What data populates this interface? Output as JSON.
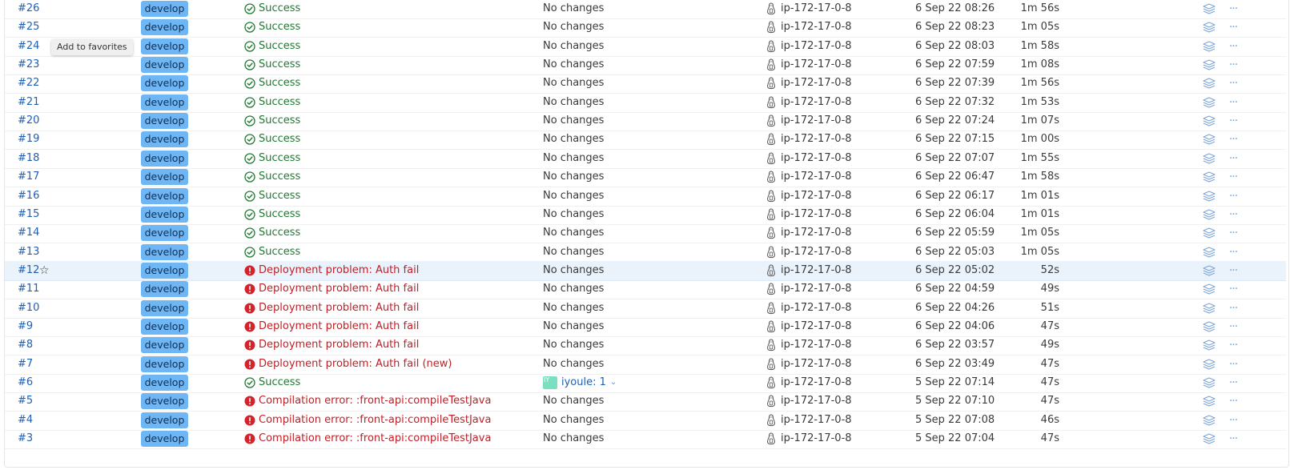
{
  "tooltip": "Add to favorites",
  "colors": {
    "success": "#1f7a32",
    "error": "#c01f27",
    "branch_badge": "#6fb7f4",
    "link": "#1f5fb4",
    "highlight_row": "#eaf3fc"
  },
  "icons": {
    "success": "check-circle-icon",
    "error": "exclamation-circle-icon",
    "agent": "linux-tux-icon",
    "artifacts": "layers-icon",
    "actions": "more-horizontal-icon",
    "favorite": "star-outline-icon"
  },
  "builds": [
    {
      "number": "#26",
      "branch": "develop",
      "status": "success",
      "status_text": "Success",
      "changes": "No changes",
      "agent": "ip-172-17-0-8",
      "started": "6 Sep 22 08:26",
      "duration": "1m 56s"
    },
    {
      "number": "#25",
      "branch": "develop",
      "status": "success",
      "status_text": "Success",
      "changes": "No changes",
      "agent": "ip-172-17-0-8",
      "started": "6 Sep 22 08:23",
      "duration": "1m 05s"
    },
    {
      "number": "#24",
      "branch": "develop",
      "status": "success",
      "status_text": "Success",
      "changes": "No changes",
      "agent": "ip-172-17-0-8",
      "started": "6 Sep 22 08:03",
      "duration": "1m 58s"
    },
    {
      "number": "#23",
      "branch": "develop",
      "status": "success",
      "status_text": "Success",
      "changes": "No changes",
      "agent": "ip-172-17-0-8",
      "started": "6 Sep 22 07:59",
      "duration": "1m 08s"
    },
    {
      "number": "#22",
      "branch": "develop",
      "status": "success",
      "status_text": "Success",
      "changes": "No changes",
      "agent": "ip-172-17-0-8",
      "started": "6 Sep 22 07:39",
      "duration": "1m 56s"
    },
    {
      "number": "#21",
      "branch": "develop",
      "status": "success",
      "status_text": "Success",
      "changes": "No changes",
      "agent": "ip-172-17-0-8",
      "started": "6 Sep 22 07:32",
      "duration": "1m 53s"
    },
    {
      "number": "#20",
      "branch": "develop",
      "status": "success",
      "status_text": "Success",
      "changes": "No changes",
      "agent": "ip-172-17-0-8",
      "started": "6 Sep 22 07:24",
      "duration": "1m 07s"
    },
    {
      "number": "#19",
      "branch": "develop",
      "status": "success",
      "status_text": "Success",
      "changes": "No changes",
      "agent": "ip-172-17-0-8",
      "started": "6 Sep 22 07:15",
      "duration": "1m 00s"
    },
    {
      "number": "#18",
      "branch": "develop",
      "status": "success",
      "status_text": "Success",
      "changes": "No changes",
      "agent": "ip-172-17-0-8",
      "started": "6 Sep 22 07:07",
      "duration": "1m 55s"
    },
    {
      "number": "#17",
      "branch": "develop",
      "status": "success",
      "status_text": "Success",
      "changes": "No changes",
      "agent": "ip-172-17-0-8",
      "started": "6 Sep 22 06:47",
      "duration": "1m 58s"
    },
    {
      "number": "#16",
      "branch": "develop",
      "status": "success",
      "status_text": "Success",
      "changes": "No changes",
      "agent": "ip-172-17-0-8",
      "started": "6 Sep 22 06:17",
      "duration": "1m 01s"
    },
    {
      "number": "#15",
      "branch": "develop",
      "status": "success",
      "status_text": "Success",
      "changes": "No changes",
      "agent": "ip-172-17-0-8",
      "started": "6 Sep 22 06:04",
      "duration": "1m 01s"
    },
    {
      "number": "#14",
      "branch": "develop",
      "status": "success",
      "status_text": "Success",
      "changes": "No changes",
      "agent": "ip-172-17-0-8",
      "started": "6 Sep 22 05:59",
      "duration": "1m 05s"
    },
    {
      "number": "#13",
      "branch": "develop",
      "status": "success",
      "status_text": "Success",
      "changes": "No changes",
      "agent": "ip-172-17-0-8",
      "started": "6 Sep 22 05:03",
      "duration": "1m 05s"
    },
    {
      "number": "#12",
      "branch": "develop",
      "status": "error",
      "status_text": "Deployment problem: Auth fail",
      "changes": "No changes",
      "agent": "ip-172-17-0-8",
      "started": "6 Sep 22 05:02",
      "duration": "52s",
      "highlighted": true,
      "star": "☆"
    },
    {
      "number": "#11",
      "branch": "develop",
      "status": "error",
      "status_text": "Deployment problem: Auth fail",
      "changes": "No changes",
      "agent": "ip-172-17-0-8",
      "started": "6 Sep 22 04:59",
      "duration": "49s"
    },
    {
      "number": "#10",
      "branch": "develop",
      "status": "error",
      "status_text": "Deployment problem: Auth fail",
      "changes": "No changes",
      "agent": "ip-172-17-0-8",
      "started": "6 Sep 22 04:26",
      "duration": "51s"
    },
    {
      "number": "#9",
      "branch": "develop",
      "status": "error",
      "status_text": "Deployment problem: Auth fail",
      "changes": "No changes",
      "agent": "ip-172-17-0-8",
      "started": "6 Sep 22 04:06",
      "duration": "47s"
    },
    {
      "number": "#8",
      "branch": "develop",
      "status": "error",
      "status_text": "Deployment problem: Auth fail",
      "changes": "No changes",
      "agent": "ip-172-17-0-8",
      "started": "6 Sep 22 03:57",
      "duration": "49s"
    },
    {
      "number": "#7",
      "branch": "develop",
      "status": "error",
      "status_text": "Deployment problem: Auth fail (new)",
      "changes": "No changes",
      "agent": "ip-172-17-0-8",
      "started": "6 Sep 22 03:49",
      "duration": "47s"
    },
    {
      "number": "#6",
      "branch": "develop",
      "status": "success",
      "status_text": "Success",
      "changes": "",
      "committer": {
        "initials": "IY",
        "label": "iyoule: 1"
      },
      "agent": "ip-172-17-0-8",
      "started": "5 Sep 22 07:14",
      "duration": "47s"
    },
    {
      "number": "#5",
      "branch": "develop",
      "status": "error",
      "status_text": "Compilation error: :front-api:compileTestJava",
      "changes": "No changes",
      "agent": "ip-172-17-0-8",
      "started": "5 Sep 22 07:10",
      "duration": "47s"
    },
    {
      "number": "#4",
      "branch": "develop",
      "status": "error",
      "status_text": "Compilation error: :front-api:compileTestJava",
      "changes": "No changes",
      "agent": "ip-172-17-0-8",
      "started": "5 Sep 22 07:08",
      "duration": "46s"
    },
    {
      "number": "#3",
      "branch": "develop",
      "status": "error",
      "status_text": "Compilation error: :front-api:compileTestJava",
      "changes": "No changes",
      "agent": "ip-172-17-0-8",
      "started": "5 Sep 22 07:04",
      "duration": "47s"
    }
  ]
}
